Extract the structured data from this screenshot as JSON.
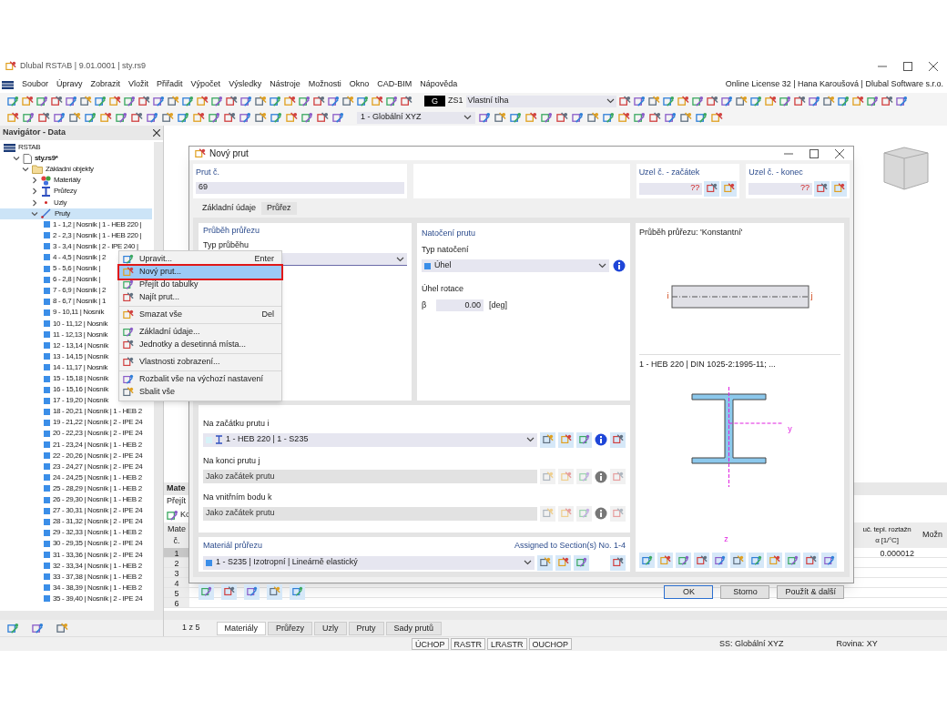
{
  "window": {
    "title": "Dlubal RSTAB | 9.01.0001 | sty.rs9"
  },
  "menu": [
    "Soubor",
    "Úpravy",
    "Zobrazit",
    "Vložit",
    "Přiřadit",
    "Výpočet",
    "Výsledky",
    "Nástroje",
    "Možnosti",
    "Okno",
    "CAD-BIM",
    "Nápověda"
  ],
  "license": "Online License 32 | Hana Karoušová | Dlubal Software s.r.o.",
  "toolbar": {
    "load_type": "G",
    "load_case": "ZS1",
    "load_case_name": "Vlastní tíha",
    "coordinate_system": "1 - Globální XYZ"
  },
  "navigator": {
    "title": "Navigátor - Data",
    "tree": [
      {
        "label": "RSTAB",
        "kind": "root",
        "selected": false,
        "children": [
          {
            "label": "sty.rs9*",
            "kind": "file",
            "expanded": true,
            "selected": false,
            "children": [
              {
                "label": "Základní objekty",
                "kind": "folder",
                "expanded": true,
                "selected": false,
                "children": [
                  {
                    "label": "Materiály",
                    "kind": "materials",
                    "expanded": false,
                    "selected": false
                  },
                  {
                    "label": "Průřezy",
                    "kind": "sections",
                    "expanded": false,
                    "selected": false
                  },
                  {
                    "label": "Uzly",
                    "kind": "nodes",
                    "expanded": false,
                    "selected": false
                  },
                  {
                    "label": "Pruty",
                    "kind": "members",
                    "expanded": true,
                    "selected": true,
                    "children": [
                      {
                        "label": "1 - 1,2 | Nosník | 1 - HEB 220 |",
                        "kind": "member",
                        "selected": false
                      },
                      {
                        "label": "2 - 2,3 | Nosník | 1 - HEB 220 |",
                        "kind": "member",
                        "selected": false
                      },
                      {
                        "label": "3 - 3,4 | Nosník | 2 - IPE 240 |",
                        "kind": "member",
                        "selected": false
                      },
                      {
                        "label": "4 - 4,5 | Nosník | 2",
                        "kind": "member",
                        "selected": false
                      },
                      {
                        "label": "5 - 5,6 | Nosník |",
                        "kind": "member",
                        "selected": false
                      },
                      {
                        "label": "6 - 2,8 | Nosník |",
                        "kind": "member",
                        "selected": false
                      },
                      {
                        "label": "7 - 6,9 | Nosník | 2",
                        "kind": "member",
                        "selected": false
                      },
                      {
                        "label": "8 - 6,7 | Nosník | 1",
                        "kind": "member",
                        "selected": false
                      },
                      {
                        "label": "9 - 10,11 | Nosník",
                        "kind": "member",
                        "selected": false
                      },
                      {
                        "label": "10 - 11,12 | Nosník",
                        "kind": "member",
                        "selected": false
                      },
                      {
                        "label": "11 - 12,13 | Nosník",
                        "kind": "member",
                        "selected": false
                      },
                      {
                        "label": "12 - 13,14 | Nosník",
                        "kind": "member",
                        "selected": false
                      },
                      {
                        "label": "13 - 14,15 | Nosník",
                        "kind": "member",
                        "selected": false
                      },
                      {
                        "label": "14 - 11,17 | Nosník",
                        "kind": "member",
                        "selected": false
                      },
                      {
                        "label": "15 - 15,18 | Nosník",
                        "kind": "member",
                        "selected": false
                      },
                      {
                        "label": "16 - 15,16 | Nosník",
                        "kind": "member",
                        "selected": false
                      },
                      {
                        "label": "17 - 19,20 | Nosník",
                        "kind": "member",
                        "selected": false
                      },
                      {
                        "label": "18 - 20,21 | Nosník | 1 - HEB 2",
                        "kind": "member",
                        "selected": false
                      },
                      {
                        "label": "19 - 21,22 | Nosník | 2 - IPE 24",
                        "kind": "member",
                        "selected": false
                      },
                      {
                        "label": "20 - 22,23 | Nosník | 2 - IPE 24",
                        "kind": "member",
                        "selected": false
                      },
                      {
                        "label": "21 - 23,24 | Nosník | 1 - HEB 2",
                        "kind": "member",
                        "selected": false
                      },
                      {
                        "label": "22 - 20,26 | Nosník | 2 - IPE 24",
                        "kind": "member",
                        "selected": false
                      },
                      {
                        "label": "23 - 24,27 | Nosník | 2 - IPE 24",
                        "kind": "member",
                        "selected": false
                      },
                      {
                        "label": "24 - 24,25 | Nosník | 1 - HEB 2",
                        "kind": "member",
                        "selected": false
                      },
                      {
                        "label": "25 - 28,29 | Nosník | 1 - HEB 2",
                        "kind": "member",
                        "selected": false
                      },
                      {
                        "label": "26 - 29,30 | Nosník | 1 - HEB 2",
                        "kind": "member",
                        "selected": false
                      },
                      {
                        "label": "27 - 30,31 | Nosník | 2 - IPE 24",
                        "kind": "member",
                        "selected": false
                      },
                      {
                        "label": "28 - 31,32 | Nosník | 2 - IPE 24",
                        "kind": "member",
                        "selected": false
                      },
                      {
                        "label": "29 - 32,33 | Nosník | 1 - HEB 2",
                        "kind": "member",
                        "selected": false
                      },
                      {
                        "label": "30 - 29,35 | Nosník | 2 - IPE 24",
                        "kind": "member",
                        "selected": false
                      },
                      {
                        "label": "31 - 33,36 | Nosník | 2 - IPE 24",
                        "kind": "member",
                        "selected": false
                      },
                      {
                        "label": "32 - 33,34 | Nosník | 1 - HEB 2",
                        "kind": "member",
                        "selected": false
                      },
                      {
                        "label": "33 - 37,38 | Nosník | 1 - HEB 2",
                        "kind": "member",
                        "selected": false
                      },
                      {
                        "label": "34 - 38,39 | Nosník | 1 - HEB 2",
                        "kind": "member",
                        "selected": false
                      },
                      {
                        "label": "35 - 39,40 | Nosník | 2 - IPE 24",
                        "kind": "member",
                        "selected": false
                      }
                    ]
                  }
                ]
              }
            ]
          }
        ]
      }
    ]
  },
  "context_menu": [
    [
      {
        "label": "Upravit...",
        "shortcut": "Enter",
        "selected": false
      },
      {
        "label": "Nový prut...",
        "selected": true
      },
      {
        "label": "Přejít do tabulky",
        "selected": false
      },
      {
        "label": "Najít prut...",
        "selected": false
      }
    ],
    [
      {
        "label": "Smazat vše",
        "shortcut": "Del",
        "selected": false
      }
    ],
    [
      {
        "label": "Základní údaje...",
        "selected": false
      },
      {
        "label": "Jednotky a desetinná místa...",
        "selected": false
      }
    ],
    [
      {
        "label": "Vlastnosti zobrazení...",
        "selected": false
      }
    ],
    [
      {
        "label": "Rozbalit vše na výchozí nastavení",
        "selected": false
      },
      {
        "label": "Sbalit vše",
        "selected": false
      }
    ]
  ],
  "table_panel": {
    "title": "Mate",
    "goto": "Přejít",
    "tool": "Ko",
    "columns": [
      {
        "lines": [
          "Mate",
          "č."
        ]
      },
      {
        "lines": [
          "uč. tepl. roztažn",
          "α [1/°C]"
        ]
      },
      {
        "lines": [
          "Možn"
        ]
      }
    ],
    "rows": [
      {
        "no": "1",
        "value": "0.000012",
        "selected": true
      },
      {
        "no": "2",
        "selected": false
      },
      {
        "no": "3",
        "selected": false
      },
      {
        "no": "4",
        "selected": false
      },
      {
        "no": "5",
        "selected": false
      },
      {
        "no": "6",
        "selected": false
      }
    ],
    "pager": "1 z 5",
    "tabs": [
      {
        "label": "Materiály",
        "selected": true
      },
      {
        "label": "Průřezy",
        "selected": false
      },
      {
        "label": "Uzly",
        "selected": false
      },
      {
        "label": "Pruty",
        "selected": false
      },
      {
        "label": "Sady prutů",
        "selected": false
      }
    ]
  },
  "status_bar": {
    "toggles": [
      "ÚCHOP",
      "RASTR",
      "LRASTR",
      "OUCHOP"
    ],
    "cs": "SS: Globální XYZ",
    "plane": "Rovina: XY"
  },
  "dialog": {
    "title": "Nový prut",
    "member_no": {
      "label": "Prut č.",
      "value": "69"
    },
    "node_start": {
      "label": "Uzel č. - začátek",
      "value": "??"
    },
    "node_end": {
      "label": "Uzel č. - konec",
      "value": "??"
    },
    "tabs": [
      {
        "label": "Základní údaje",
        "selected": false
      },
      {
        "label": "Průřez",
        "selected": true
      }
    ],
    "distribution": {
      "title": "Průběh průřezu",
      "type_label": "Typ průběhu"
    },
    "rotation": {
      "title": "Natočení prutu",
      "type_label": "Typ natočení",
      "type_value": "Úhel",
      "angle_label": "Úhel rotace",
      "symbol": "β",
      "value": "0.00",
      "unit": "[deg]"
    },
    "sections": [
      {
        "label": "Na začátku prutu i",
        "value": "1 - HEB 220 | 1 - S235",
        "disabled": false
      },
      {
        "label": "Na konci prutu j",
        "value": "Jako začátek prutu",
        "disabled": true
      },
      {
        "label": "Na vnitřním bodu k",
        "value": "Jako začátek prutu",
        "disabled": true
      }
    ],
    "material": {
      "title": "Materiál průřezu",
      "note": "Assigned to Section(s) No. 1-4",
      "value": "1 - S235 | Izotropní | Lineárně elastický"
    },
    "preview": {
      "title": "Průběh průřezu: 'Konstantní'",
      "start": "i",
      "end": "j",
      "section_title": "1 - HEB 220 | DIN 1025-2:1995-11; ...",
      "axis_y": "y",
      "axis_z": "z"
    },
    "buttons": [
      {
        "label": "OK",
        "default": true
      },
      {
        "label": "Storno",
        "default": false
      },
      {
        "label": "Použít & další",
        "default": false
      }
    ]
  }
}
